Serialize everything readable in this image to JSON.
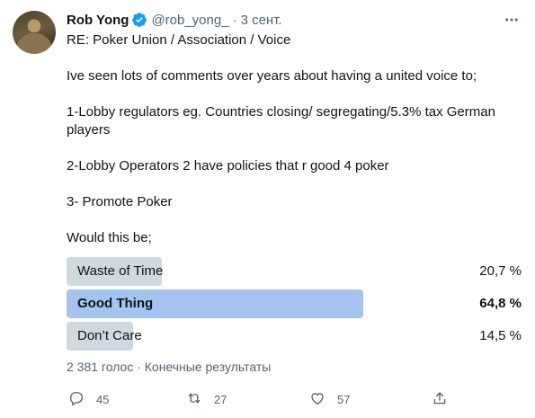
{
  "author": {
    "name": "Rob Yong",
    "handle": "@rob_yong_",
    "separator": "·",
    "time": "3 сент."
  },
  "tweet": {
    "lines": [
      "RE: Poker Union / Association / Voice",
      "Ive seen lots of comments over years about having a united voice to;",
      "1-Lobby regulators eg. Countries closing/ segregating/5.3% tax German players",
      "2-Lobby Operators 2 have policies that r good 4 poker",
      "3- Promote Poker",
      "Would this be;"
    ]
  },
  "poll": {
    "options": [
      {
        "label": "Waste of Time",
        "percent": "20,7 %",
        "fraction": 0.207,
        "winner": false
      },
      {
        "label": "Good Thing",
        "percent": "64,8 %",
        "fraction": 0.648,
        "winner": true
      },
      {
        "label": "Don’t Care",
        "percent": "14,5 %",
        "fraction": 0.145,
        "winner": false
      }
    ],
    "meta": "2 381 голос · Конечные результаты"
  },
  "actions": {
    "replies": "45",
    "retweets": "27",
    "likes": "57"
  },
  "colors": {
    "winner_bar": "#a4c4ef",
    "bar": "#cfd9de",
    "verified": "#1d9bf0",
    "muted": "#536471"
  }
}
